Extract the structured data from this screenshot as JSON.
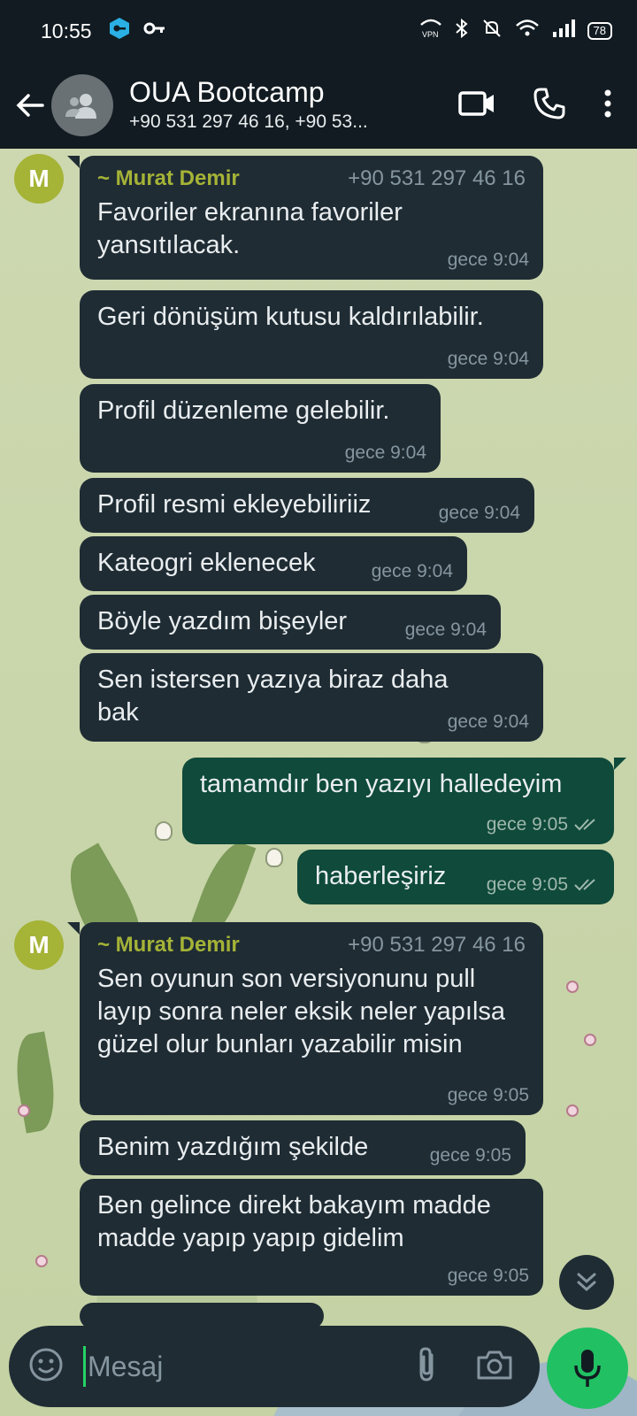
{
  "status_bar": {
    "time": "10:55",
    "battery": "78",
    "vpn": "VPN"
  },
  "header": {
    "title": "OUA Bootcamp",
    "subtitle": "+90 531 297 46 16, +90 53..."
  },
  "messages": [
    {
      "sender": "~ Murat Demir",
      "phone": "+90 531 297 46 16",
      "text": "Favoriler ekranına favoriler yansıtılacak.",
      "time": "gece 9:04"
    },
    {
      "text": "Geri dönüşüm kutusu kaldırılabilir.",
      "time": "gece 9:04"
    },
    {
      "text": "Profil düzenleme gelebilir.",
      "time": "gece 9:04"
    },
    {
      "text": "Profil resmi ekleyebiliriiz",
      "time": "gece 9:04"
    },
    {
      "text": "Kateogri eklenecek",
      "time": "gece 9:04"
    },
    {
      "text": "Böyle yazdım bişeyler",
      "time": "gece 9:04"
    },
    {
      "text": "Sen istersen yazıya biraz daha bak",
      "time": "gece 9:04"
    },
    {
      "text": "tamamdır ben yazıyı halledeyim",
      "time": "gece 9:05"
    },
    {
      "text": "haberleşiriz",
      "time": "gece 9:05"
    },
    {
      "sender": "~ Murat Demir",
      "phone": "+90 531 297 46 16",
      "text": "Sen oyunun son versiyonunu pull layıp sonra neler eksik neler yapılsa güzel olur bunları yazabilir misin",
      "time": "gece 9:05"
    },
    {
      "text": "Benim yazdığım şekilde",
      "time": "gece 9:05"
    },
    {
      "text": "Ben gelince direkt bakayım madde madde yapıp yapıp gidelim",
      "time": "gece 9:05"
    }
  ],
  "avatar_letter": "M",
  "composer": {
    "placeholder": "Mesaj"
  },
  "colors": {
    "header_bg": "#111b21",
    "incoming_bg": "#1f2c34",
    "outgoing_bg": "#0f4a3a",
    "sender_color": "#a5b337",
    "accent": "#21c063"
  }
}
